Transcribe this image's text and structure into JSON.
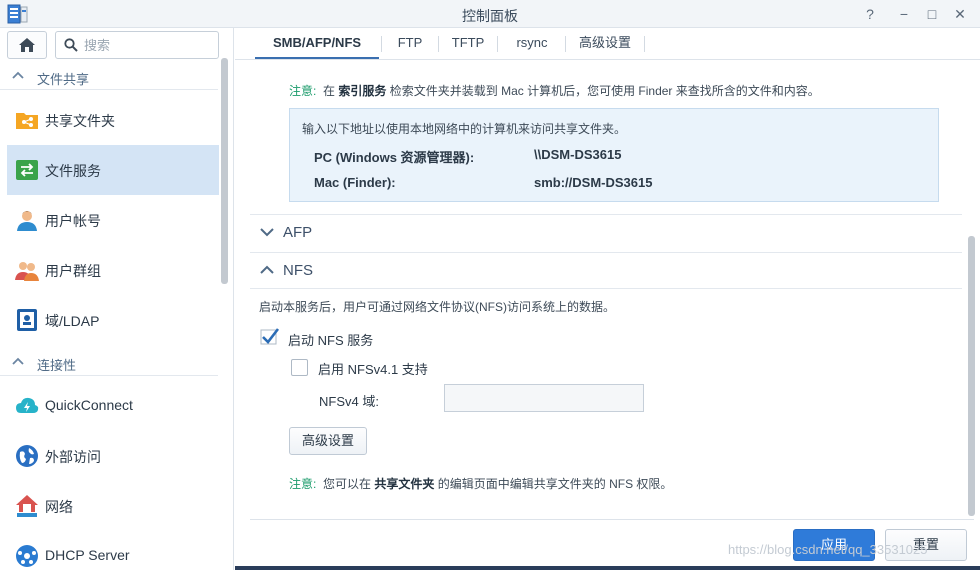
{
  "window": {
    "title": "控制面板",
    "controls": {
      "help": "?",
      "minimize": "−",
      "maximize": "□",
      "close": "✕"
    }
  },
  "sidebar": {
    "search_placeholder": "搜索",
    "sections": [
      {
        "label": "文件共享",
        "items": [
          {
            "label": "共享文件夹",
            "icon": "shared-folder-icon",
            "active": false
          },
          {
            "label": "文件服务",
            "icon": "file-services-icon",
            "active": true
          },
          {
            "label": "用户帐号",
            "icon": "user-icon",
            "active": false
          },
          {
            "label": "用户群组",
            "icon": "group-icon",
            "active": false
          },
          {
            "label": "域/LDAP",
            "icon": "domain-ldap-icon",
            "active": false
          }
        ]
      },
      {
        "label": "连接性",
        "items": [
          {
            "label": "QuickConnect",
            "icon": "quickconnect-icon",
            "active": false
          },
          {
            "label": "外部访问",
            "icon": "external-access-icon",
            "active": false
          },
          {
            "label": "网络",
            "icon": "network-icon",
            "active": false
          },
          {
            "label": "DHCP Server",
            "icon": "dhcp-server-icon",
            "active": false
          }
        ]
      }
    ]
  },
  "tabs": [
    {
      "label": "SMB/AFP/NFS",
      "active": true
    },
    {
      "label": "FTP",
      "active": false
    },
    {
      "label": "TFTP",
      "active": false
    },
    {
      "label": "rsync",
      "active": false
    },
    {
      "label": "高级设置",
      "active": false
    }
  ],
  "smb": {
    "note_prefix": "注意:",
    "note_part1": "在",
    "note_link": "索引服务",
    "note_part2": "检索文件夹并装载到 Mac 计算机后，您可使用 Finder 来查找所含的文件和内容。",
    "info_intro": "输入以下地址以使用本地网络中的计算机来访问共享文件夹。",
    "rows": [
      {
        "label": "PC (Windows 资源管理器):",
        "value": "\\\\DSM-DS3615"
      },
      {
        "label": "Mac (Finder):",
        "value": "smb://DSM-DS3615"
      }
    ]
  },
  "afp": {
    "title": "AFP",
    "expanded": false
  },
  "nfs": {
    "title": "NFS",
    "expanded": true,
    "description": "启动本服务后，用户可通过网络文件协议(NFS)访问系统上的数据。",
    "enable_label": "启动 NFS 服务",
    "enable_checked": true,
    "nfsv41_label": "启用 NFSv4.1 支持",
    "nfsv41_checked": false,
    "domain_label": "NFSv4 域:",
    "domain_value": "",
    "advanced_button": "高级设置",
    "note_prefix": "注意:",
    "note_part1": "您可以在",
    "note_link": "共享文件夹",
    "note_part2": "的编辑页面中编辑共享文件夹的 NFS 权限。"
  },
  "footer": {
    "apply_label": "应用",
    "reset_label": "重置"
  },
  "watermark": "https://blog.csdn.net/qq_33531025",
  "colors": {
    "accent": "#2f7bd9",
    "active_nav": "#d4e4f5",
    "note_green": "#1b9b6b",
    "info_box": "#eaf3fb"
  }
}
